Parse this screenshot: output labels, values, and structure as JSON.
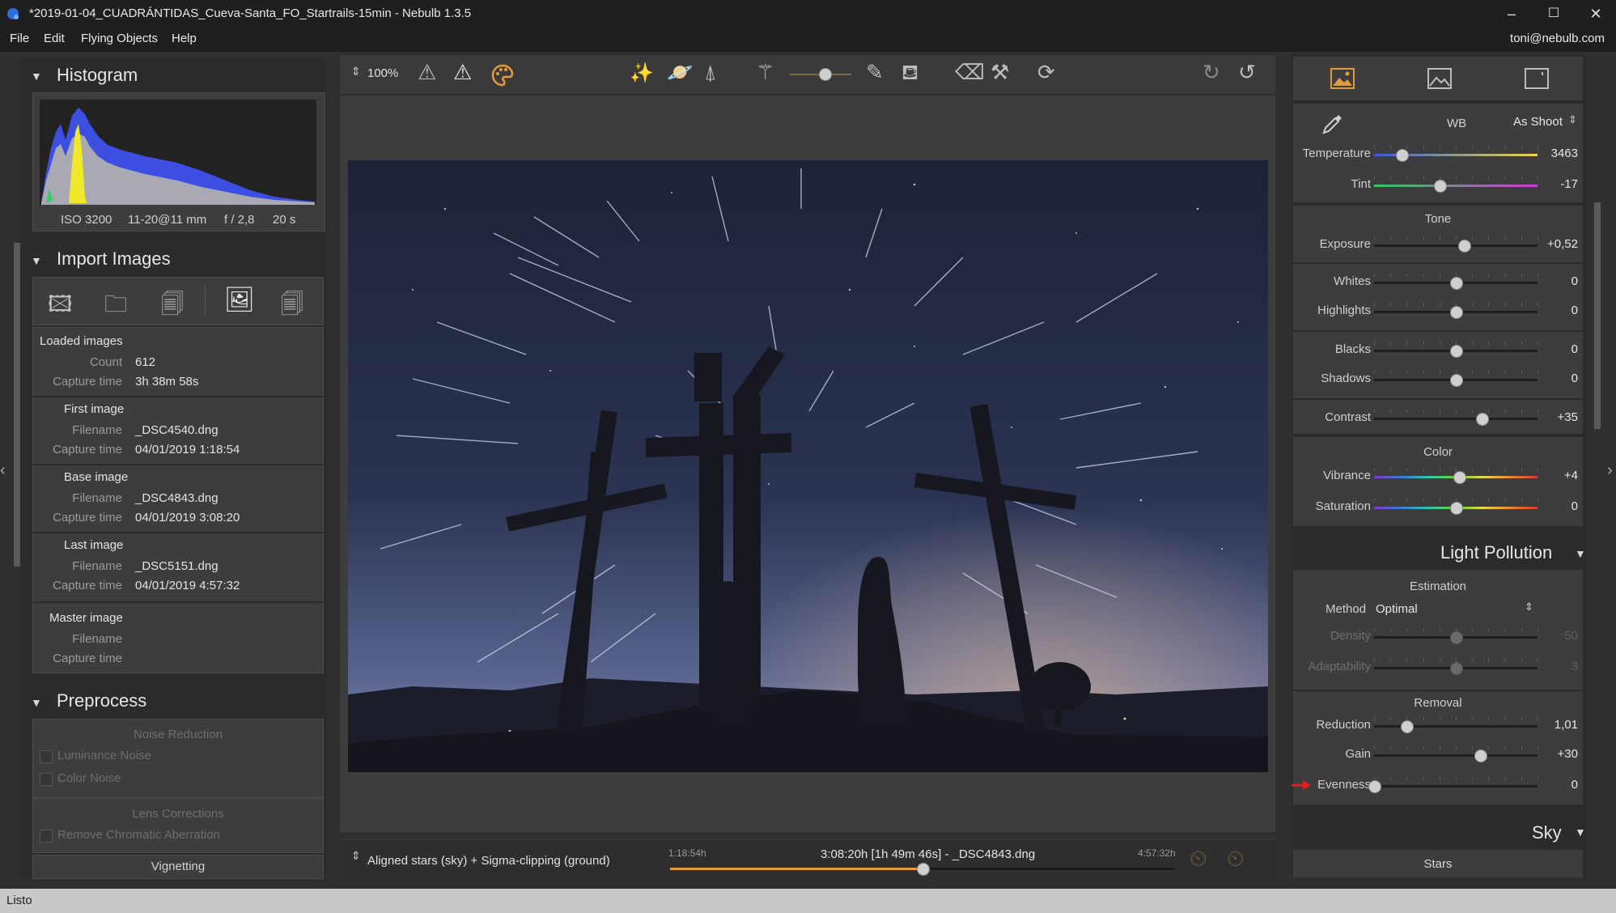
{
  "window": {
    "title": "*2019-01-04_CUADRÁNTIDAS_Cueva-Santa_FO_Startrails-15min - Nebulb 1.3.5",
    "minimize": "–",
    "maximize": "☐",
    "close": "✕"
  },
  "menu": {
    "file": "File",
    "edit": "Edit",
    "flying_objects": "Flying Objects",
    "help": "Help",
    "account": "toni@nebulb.com"
  },
  "histogram": {
    "header": "Histogram",
    "iso": "ISO 3200",
    "lens": "11-20@11 mm",
    "aperture": "f / 2,8",
    "exposure": "20 s"
  },
  "import": {
    "header": "Import Images",
    "loaded": {
      "title": "Loaded images",
      "count_label": "Count",
      "count": "612",
      "capture_label": "Capture time",
      "capture": "3h 38m 58s"
    },
    "first": {
      "title": "First image",
      "filename_label": "Filename",
      "filename": "_DSC4540.dng",
      "capture_label": "Capture time",
      "capture": "04/01/2019 1:18:54"
    },
    "base": {
      "title": "Base image",
      "filename_label": "Filename",
      "filename": "_DSC4843.dng",
      "capture_label": "Capture time",
      "capture": "04/01/2019 3:08:20"
    },
    "last": {
      "title": "Last image",
      "filename_label": "Filename",
      "filename": "_DSC5151.dng",
      "capture_label": "Capture time",
      "capture": "04/01/2019 4:57:32"
    },
    "master": {
      "title": "Master image",
      "filename_label": "Filename",
      "capture_label": "Capture time"
    }
  },
  "preprocess": {
    "header": "Preprocess",
    "noise_title": "Noise Reduction",
    "luminance": "Luminance Noise",
    "color": "Color Noise",
    "lens_title": "Lens Corrections",
    "chromatic": "Remove Chromatic Aberration",
    "vignetting": "Vignetting"
  },
  "toolbar": {
    "zoom": "100%"
  },
  "bottom": {
    "mode": "Aligned stars (sky) + Sigma-clipping (ground)",
    "start_time": "1:18:54h",
    "current": "3:08:20h [1h 49m 46s] - _DSC4843.dng",
    "end_time": "4:57:32h",
    "timeline_position": 0.5
  },
  "develop": {
    "wb_label": "WB",
    "wb_value": "As Shoot",
    "temperature": {
      "label": "Temperature",
      "value": "3463",
      "pos": 0.17
    },
    "tint": {
      "label": "Tint",
      "value": "-17",
      "pos": 0.4
    },
    "tone_title": "Tone",
    "exposure": {
      "label": "Exposure",
      "value": "+0,52",
      "pos": 0.55
    },
    "whites": {
      "label": "Whites",
      "value": "0",
      "pos": 0.5
    },
    "highlights": {
      "label": "Highlights",
      "value": "0",
      "pos": 0.5
    },
    "blacks": {
      "label": "Blacks",
      "value": "0",
      "pos": 0.5
    },
    "shadows": {
      "label": "Shadows",
      "value": "0",
      "pos": 0.5
    },
    "contrast": {
      "label": "Contrast",
      "value": "+35",
      "pos": 0.66
    },
    "color_title": "Color",
    "vibrance": {
      "label": "Vibrance",
      "value": "+4",
      "pos": 0.52
    },
    "saturation": {
      "label": "Saturation",
      "value": "0",
      "pos": 0.5
    }
  },
  "light_pollution": {
    "header": "Light Pollution",
    "estimation_title": "Estimation",
    "method_label": "Method",
    "method_value": "Optimal",
    "density": {
      "label": "Density",
      "value": "50",
      "pos": 0.5
    },
    "adaptability": {
      "label": "Adaptability",
      "value": "3",
      "pos": 0.5
    },
    "removal_title": "Removal",
    "reduction": {
      "label": "Reduction",
      "value": "1,01",
      "pos": 0.2
    },
    "gain": {
      "label": "Gain",
      "value": "+30",
      "pos": 0.65
    },
    "evenness": {
      "label": "Evenness",
      "value": "0",
      "pos": 0.0
    }
  },
  "sky": {
    "header": "Sky",
    "stars": "Stars"
  },
  "status": {
    "text": "Listo"
  },
  "colors": {
    "accent": "#e29a3c",
    "arrow": "#e02020"
  }
}
